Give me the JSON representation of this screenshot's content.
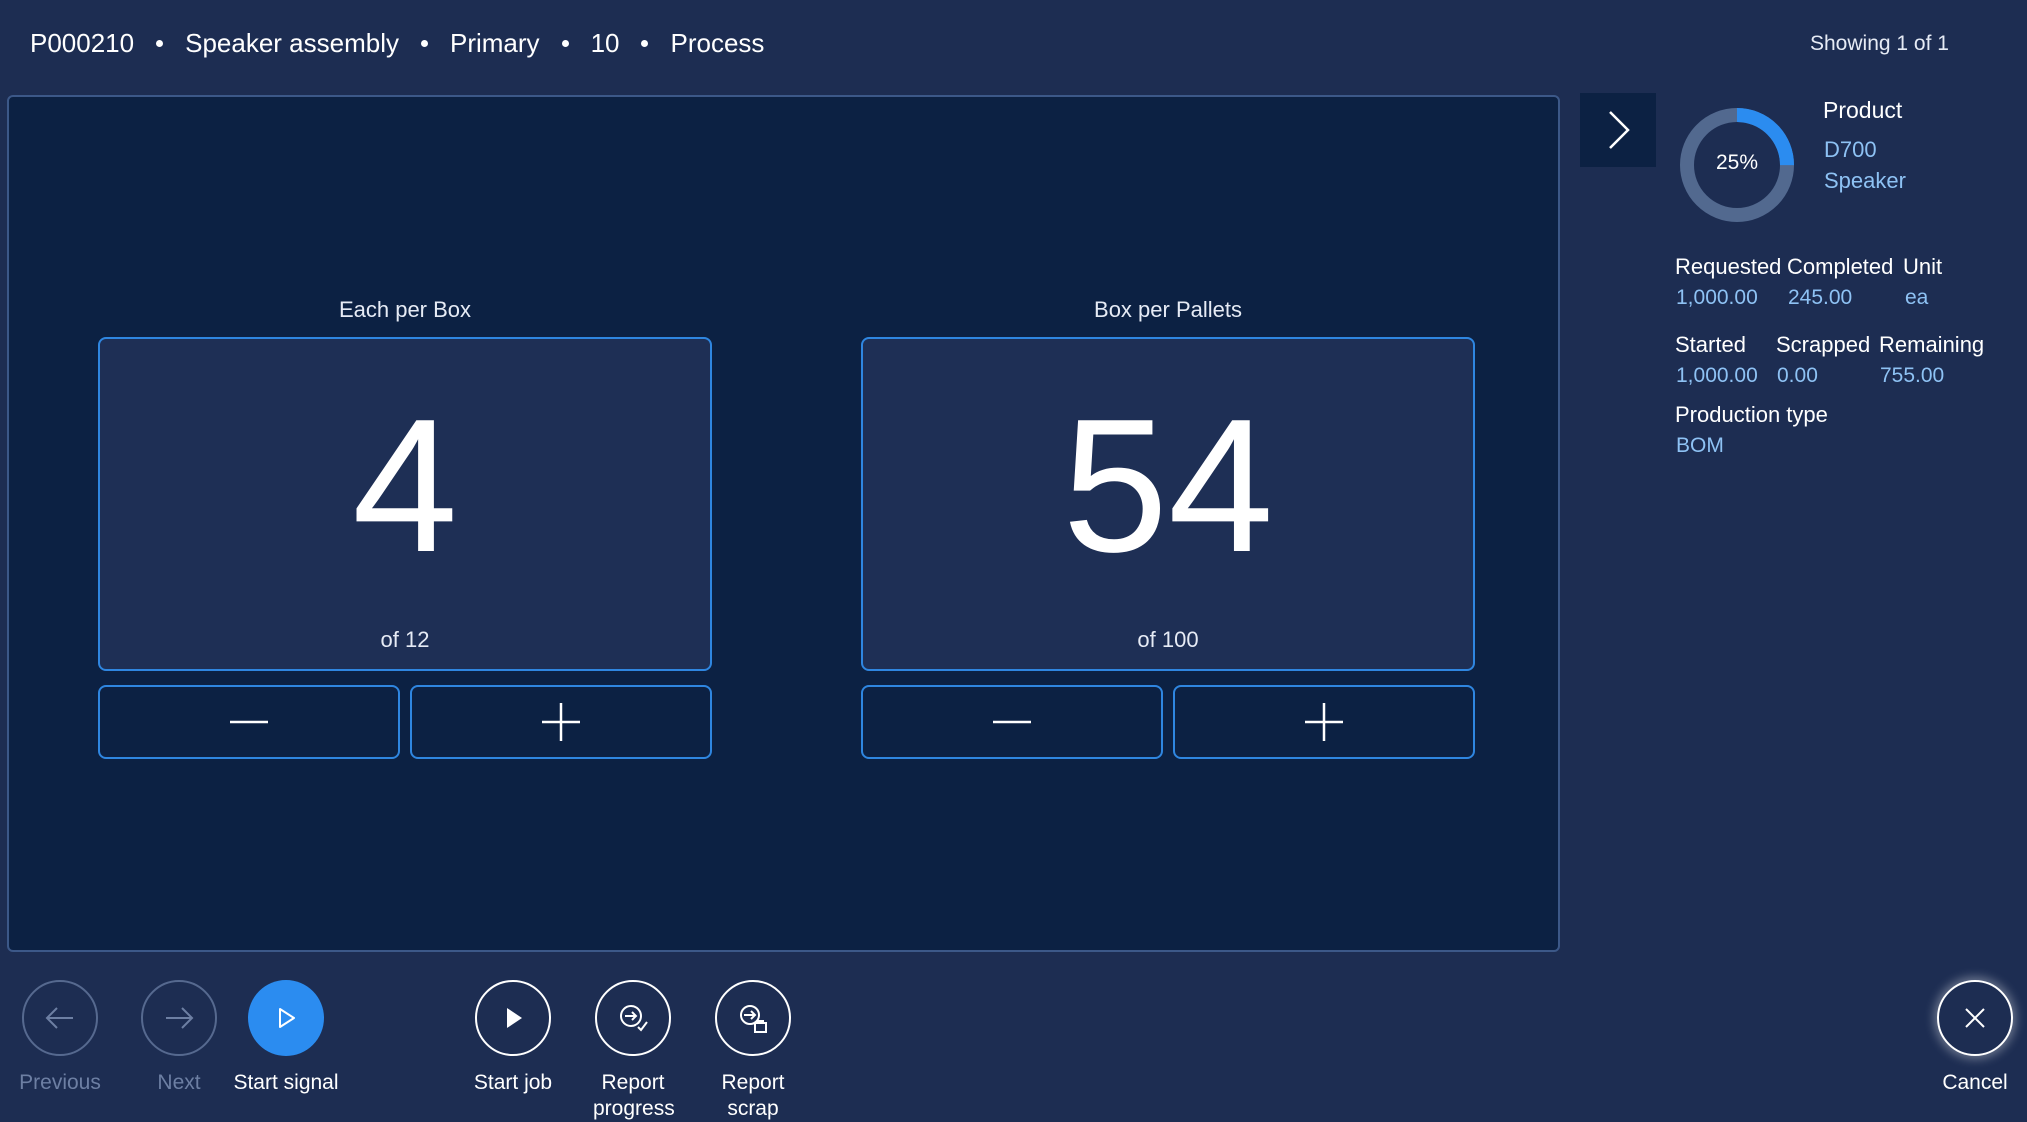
{
  "breadcrumb": [
    "P000210",
    "Speaker assembly",
    "Primary",
    "10",
    "Process"
  ],
  "showing": "Showing 1 of 1",
  "counters": [
    {
      "title": "Each per Box",
      "value": "4",
      "of": "of 12"
    },
    {
      "title": "Box per Pallets",
      "value": "54",
      "of": "of 100"
    }
  ],
  "progress": {
    "percent": 25,
    "label": "25%"
  },
  "product": {
    "label": "Product",
    "id": "D700",
    "name": "Speaker"
  },
  "info": {
    "requested": {
      "label": "Requested",
      "value": "1,000.00"
    },
    "completed": {
      "label": "Completed",
      "value": "245.00"
    },
    "unit": {
      "label": "Unit",
      "value": "ea"
    },
    "started": {
      "label": "Started",
      "value": "1,000.00"
    },
    "scrapped": {
      "label": "Scrapped",
      "value": "0.00"
    },
    "remaining": {
      "label": "Remaining",
      "value": "755.00"
    },
    "production_type": {
      "label": "Production type",
      "value": "BOM"
    }
  },
  "actions": {
    "previous": "Previous",
    "next": "Next",
    "start_signal": "Start signal",
    "start_job": "Start job",
    "report_progress": "Report progress",
    "report_scrap": "Report scrap",
    "cancel": "Cancel"
  },
  "colors": {
    "background": "#1d2d52",
    "panel": "#0c2143",
    "accent": "#2b8cf0",
    "value_text": "#8ec2f4",
    "donut_track": "#52698f"
  },
  "icons": {
    "expand": "chevron-right-icon",
    "minus": "minus-icon",
    "plus": "plus-icon",
    "previous": "arrow-left-icon",
    "next": "arrow-right-icon",
    "start_signal": "play-outline-icon",
    "start_job": "play-icon",
    "report_progress": "report-progress-icon",
    "report_scrap": "report-scrap-icon",
    "cancel": "close-icon"
  }
}
